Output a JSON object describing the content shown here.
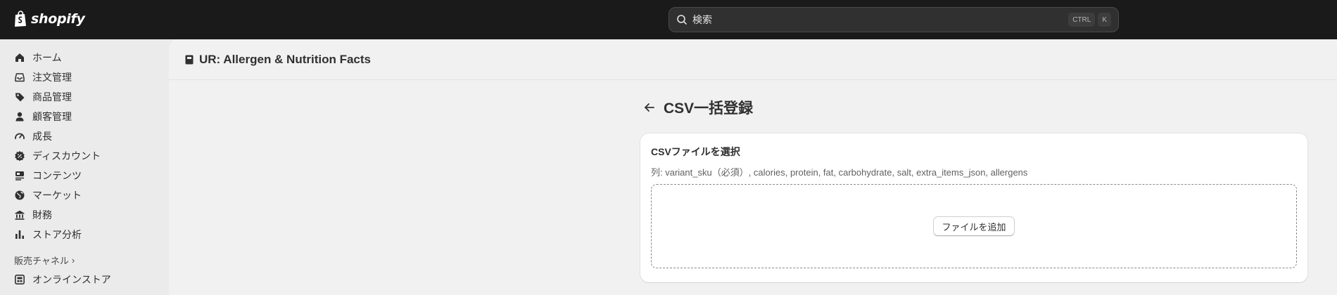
{
  "topbar": {
    "logo_text": "shopify",
    "search_placeholder": "検索",
    "shortcut_keys": [
      "CTRL",
      "K"
    ]
  },
  "sidebar": {
    "items": [
      {
        "label": "ホーム",
        "icon": "home-icon"
      },
      {
        "label": "注文管理",
        "icon": "inbox-icon"
      },
      {
        "label": "商品管理",
        "icon": "tag-icon"
      },
      {
        "label": "顧客管理",
        "icon": "person-icon"
      },
      {
        "label": "成長",
        "icon": "gauge-icon"
      },
      {
        "label": "ディスカウント",
        "icon": "discount-icon"
      },
      {
        "label": "コンテンツ",
        "icon": "content-icon"
      },
      {
        "label": "マーケット",
        "icon": "globe-icon"
      },
      {
        "label": "財務",
        "icon": "bank-icon"
      },
      {
        "label": "ストア分析",
        "icon": "bar-chart-icon"
      }
    ],
    "section_label": "販売チャネル",
    "channel_item": {
      "label": "オンラインストア",
      "icon": "store-icon"
    }
  },
  "app": {
    "title": "UR: Allergen & Nutrition Facts"
  },
  "page": {
    "title": "CSV一括登録"
  },
  "card": {
    "title": "CSVファイルを選択",
    "subtitle": "列: variant_sku（必須）, calories, protein, fat, carbohydrate, salt, extra_items_json, allergens",
    "button_label": "ファイルを追加"
  }
}
